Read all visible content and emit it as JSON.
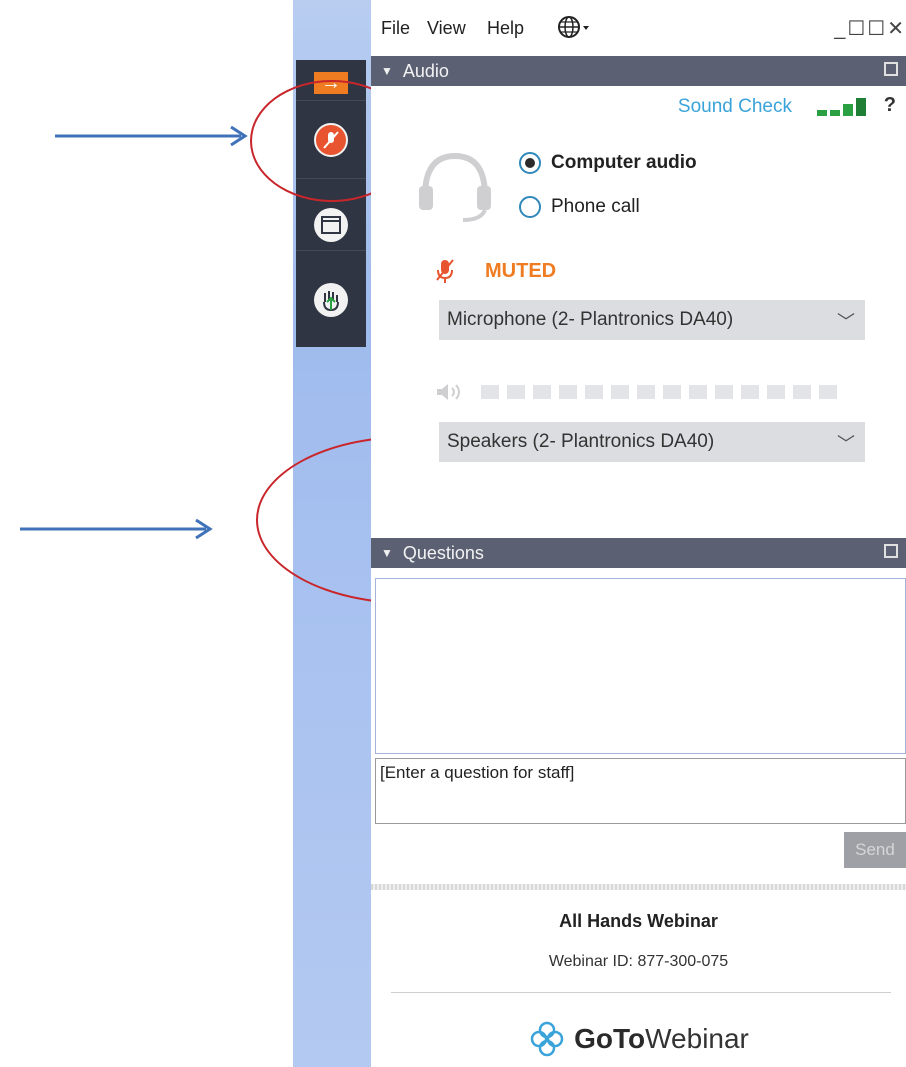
{
  "menu": {
    "file": "File",
    "view": "View",
    "help": "Help",
    "globe": "globe-icon",
    "window_controls": "_☐☐✕"
  },
  "toolbar": {
    "arrow": "→",
    "accent": "#f07c22",
    "mic_color": "#e8542f"
  },
  "audio": {
    "header": "Audio",
    "sound_check": "Sound Check",
    "help": "?",
    "computer_audio": "Computer audio",
    "phone_call": "Phone call",
    "muted": "MUTED",
    "microphone": "Microphone (2- Plantronics DA40)",
    "speakers": "Speakers (2- Plantronics DA40)"
  },
  "questions": {
    "header": "Questions",
    "input_placeholder": "[Enter a question for staff]",
    "send": "Send"
  },
  "footer": {
    "title": "All Hands Webinar",
    "webinar_id": "Webinar ID: 877-300-075",
    "logo_bold": "GoTo",
    "logo_rest": "Webinar"
  }
}
